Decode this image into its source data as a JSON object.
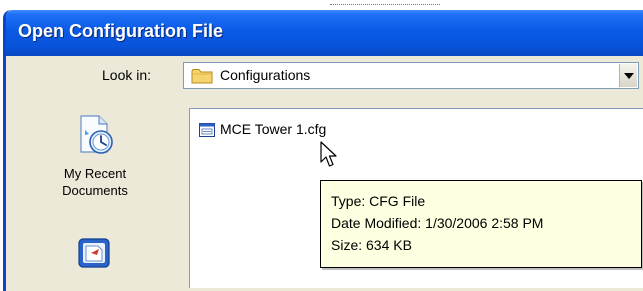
{
  "window": {
    "title": "Open Configuration File"
  },
  "look_in": {
    "label": "Look in:",
    "value": "Configurations",
    "icon": "folder-icon",
    "dropdown_icon": "chevron-down-icon"
  },
  "places_bar": {
    "items": [
      {
        "label": "My Recent Documents",
        "icon": "recent-documents-icon"
      },
      {
        "label": "",
        "icon": "desktop-icon"
      }
    ]
  },
  "file_list": {
    "items": [
      {
        "name": "MCE Tower 1.cfg",
        "icon": "config-file-icon"
      }
    ]
  },
  "tooltip": {
    "type": "Type: CFG File",
    "date_modified": "Date Modified: 1/30/2006 2:58 PM",
    "size": "Size: 634 KB"
  },
  "colors": {
    "titlebar": "#0a5ae6",
    "dialog_background": "#ece9d8",
    "tooltip_background": "#ffffe1",
    "field_border": "#7f9db9"
  }
}
